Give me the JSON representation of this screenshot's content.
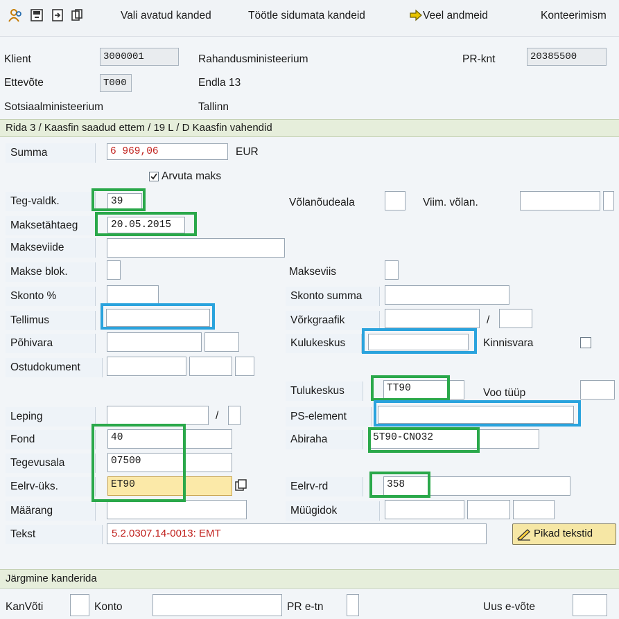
{
  "toolbar": {
    "vali_avatud": "Vali avatud kanded",
    "tootle": "Töötle sidumata kandeid",
    "veel": "Veel andmeid",
    "konteerimis": "Konteerimism"
  },
  "header": {
    "klient_label": "Klient",
    "klient_value": "3000001",
    "klient_name": "Rahandusministeerium",
    "prknt_label": "PR-knt",
    "prknt_value": "20385500",
    "ettevote_label": "Ettevõte",
    "ettevote_value": "T000",
    "ettevote_addr": "Endla 13",
    "org_name": "Sotsiaalministeerium",
    "city": "Tallinn"
  },
  "section1": {
    "title": "Rida 3 / Kaasfin saadud ettem / 19 L / D Kaasfin vahendid"
  },
  "form": {
    "summa_label": "Summa",
    "summa_value": "6 969,06",
    "currency": "EUR",
    "arvuta_label": "Arvuta maks",
    "teg_label": "Teg-valdk.",
    "teg_value": "39",
    "volan_label": "Võlanõudeala",
    "viim_label": "Viim. võlan.",
    "maksetahtaeg_label": "Maksetähtaeg",
    "maksetahtaeg_value": "20.05.2015",
    "makseviide_label": "Makseviide",
    "makseblok_label": "Makse blok.",
    "makseviis_label": "Makseviis",
    "skonto_label": "Skonto %",
    "skonto_summa_label": "Skonto summa",
    "tellimus_label": "Tellimus",
    "vorkgraafik_label": "Võrkgraafik",
    "slash": "/",
    "pohivara_label": "Põhivara",
    "kulukeskus_label": "Kulukeskus",
    "kinnisvara_label": "Kinnisvara",
    "ostudokument_label": "Ostudokument",
    "tulukeskus_label": "Tulukeskus",
    "tulukeskus_value": "TT90",
    "voo_label": "Voo tüüp",
    "leping_label": "Leping",
    "pselement_label": "PS-element",
    "fond_label": "Fond",
    "fond_value": "40",
    "abiraha_label": "Abiraha",
    "abiraha_value": "5T90-CNO32",
    "tegevusala_label": "Tegevusala",
    "tegevusala_value": "07500",
    "eelrv_uks_label": "Eelrv-üks.",
    "eelrv_uks_value": "ET90",
    "eelrv_rd_label": "Eelrv-rd",
    "eelrv_rd_value": "358",
    "maarang_label": "Määrang",
    "muugidok_label": "Müügidok",
    "tekst_label": "Tekst",
    "tekst_value": "5.2.0307.14-0013: EMT",
    "pikad_button": "Pikad tekstid"
  },
  "section2": {
    "title": "Järgmine kanderida",
    "kanvoti_label": "KanVõti",
    "konto_label": "Konto",
    "pretn_label": "PR e-tn",
    "uusevote_label": "Uus e-võte"
  },
  "colors": {
    "highlight_green": "#2aa84a",
    "highlight_blue": "#2aa3dd",
    "red_text": "#c0201c"
  }
}
